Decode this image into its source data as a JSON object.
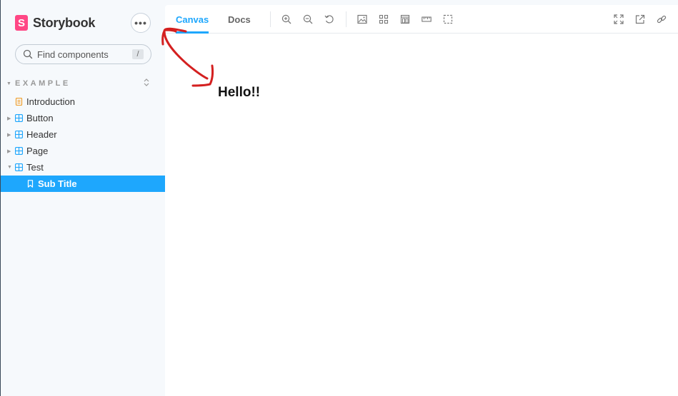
{
  "brand": {
    "name": "Storybook",
    "logo_letter": "S",
    "accent": "#ff4785"
  },
  "menu_button": {
    "icon": "ellipsis-icon",
    "label": "•••"
  },
  "search": {
    "placeholder": "Find components",
    "shortcut": "/"
  },
  "sidebar": {
    "group_title": "EXAMPLE",
    "items": [
      {
        "label": "Introduction",
        "icon": "document-icon"
      },
      {
        "label": "Button",
        "icon": "component-icon"
      },
      {
        "label": "Header",
        "icon": "component-icon"
      },
      {
        "label": "Page",
        "icon": "component-icon"
      },
      {
        "label": "Test",
        "icon": "component-icon"
      },
      {
        "label": "Sub Title",
        "icon": "bookmark-icon",
        "selected": true
      }
    ],
    "selected_color": "#1ea7fd"
  },
  "toolbar": {
    "tabs": [
      {
        "label": "Canvas",
        "active": true
      },
      {
        "label": "Docs",
        "active": false
      }
    ],
    "tools": [
      "zoom-in-icon",
      "zoom-out-icon",
      "reset-zoom-icon",
      "background-icon",
      "grid-icon",
      "viewport-icon",
      "measure-icon",
      "outline-icon"
    ],
    "right_tools": [
      "fullscreen-icon",
      "open-new-tab-icon",
      "copy-link-icon"
    ]
  },
  "canvas": {
    "text": "Hello!!"
  },
  "annotation": {
    "color": "#d42020",
    "shape": "double-headed-arrow"
  }
}
